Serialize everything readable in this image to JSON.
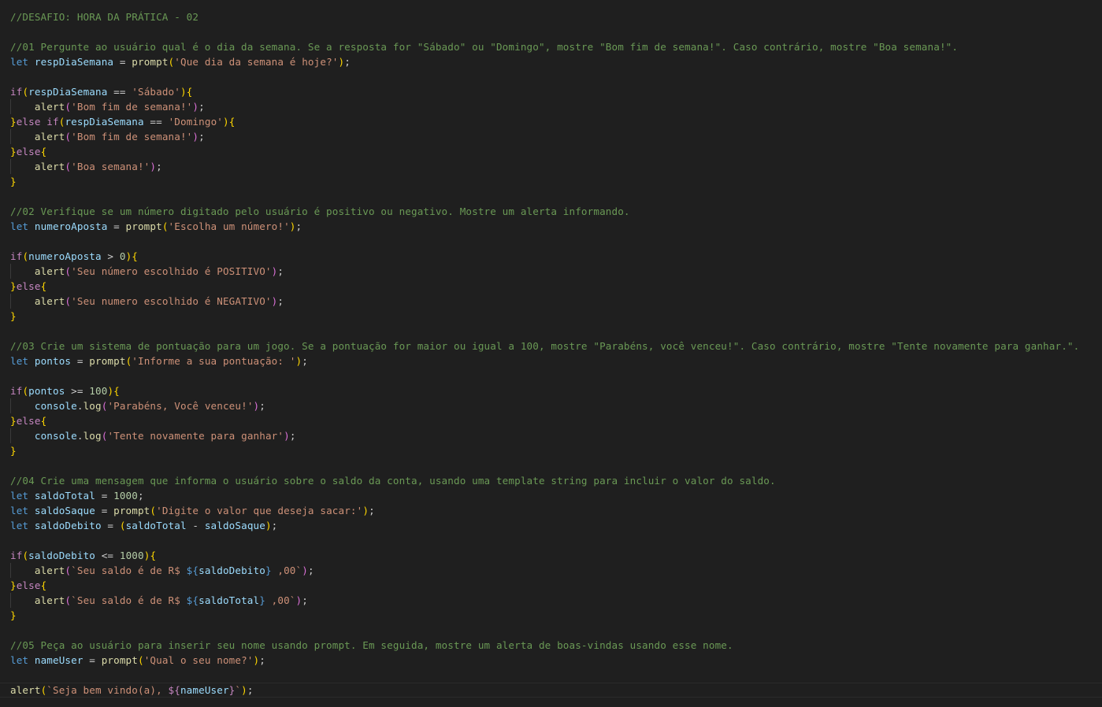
{
  "colors": {
    "background": "#1f1f1f",
    "comment": "#6a9955",
    "keyword": "#569cd6",
    "control": "#c586c0",
    "variable": "#9cdcfe",
    "function": "#dcdcaa",
    "string": "#ce9178",
    "number": "#b5cea8",
    "brace_gold": "#ffd700",
    "brace_purple": "#da70d6",
    "brace_blue": "#179fff",
    "plain": "#cccccc"
  },
  "lines": [
    {
      "tokens": [
        [
          "//DESAFIO: HORA DA PRÁTICA - 02",
          "comment"
        ]
      ]
    },
    {
      "tokens": []
    },
    {
      "tokens": [
        [
          "//01 Pergunte ao usuário qual é o dia da semana. Se a resposta for \"Sábado\" ou \"Domingo\", mostre \"Bom fim de semana!\". Caso contrário, mostre \"Boa semana!\".",
          "comment"
        ]
      ]
    },
    {
      "tokens": [
        [
          "let",
          "keyword"
        ],
        [
          " ",
          "plain"
        ],
        [
          "respDiaSemana",
          "variable"
        ],
        [
          " = ",
          "plain"
        ],
        [
          "prompt",
          "function"
        ],
        [
          "(",
          "brace_gold"
        ],
        [
          "'Que dia da semana é hoje?'",
          "string"
        ],
        [
          ")",
          "brace_gold"
        ],
        [
          ";",
          "plain"
        ]
      ]
    },
    {
      "tokens": []
    },
    {
      "tokens": [
        [
          "if",
          "control"
        ],
        [
          "(",
          "brace_gold"
        ],
        [
          "respDiaSemana",
          "variable"
        ],
        [
          " == ",
          "plain"
        ],
        [
          "'Sábado'",
          "string"
        ],
        [
          ")",
          "brace_gold"
        ],
        [
          "{",
          "brace_gold"
        ]
      ]
    },
    {
      "indent": true,
      "tokens": [
        [
          "    ",
          "plain"
        ],
        [
          "alert",
          "function"
        ],
        [
          "(",
          "brace_purple"
        ],
        [
          "'Bom fim de semana!'",
          "string"
        ],
        [
          ")",
          "brace_purple"
        ],
        [
          ";",
          "plain"
        ]
      ]
    },
    {
      "tokens": [
        [
          "}",
          "brace_gold"
        ],
        [
          "else",
          "control"
        ],
        [
          " ",
          "plain"
        ],
        [
          "if",
          "control"
        ],
        [
          "(",
          "brace_gold"
        ],
        [
          "respDiaSemana",
          "variable"
        ],
        [
          " == ",
          "plain"
        ],
        [
          "'Domingo'",
          "string"
        ],
        [
          ")",
          "brace_gold"
        ],
        [
          "{",
          "brace_gold"
        ]
      ]
    },
    {
      "indent": true,
      "tokens": [
        [
          "    ",
          "plain"
        ],
        [
          "alert",
          "function"
        ],
        [
          "(",
          "brace_purple"
        ],
        [
          "'Bom fim de semana!'",
          "string"
        ],
        [
          ")",
          "brace_purple"
        ],
        [
          ";",
          "plain"
        ]
      ]
    },
    {
      "tokens": [
        [
          "}",
          "brace_gold"
        ],
        [
          "else",
          "control"
        ],
        [
          "{",
          "brace_gold"
        ]
      ]
    },
    {
      "indent": true,
      "tokens": [
        [
          "    ",
          "plain"
        ],
        [
          "alert",
          "function"
        ],
        [
          "(",
          "brace_purple"
        ],
        [
          "'Boa semana!'",
          "string"
        ],
        [
          ")",
          "brace_purple"
        ],
        [
          ";",
          "plain"
        ]
      ]
    },
    {
      "tokens": [
        [
          "}",
          "brace_gold"
        ]
      ]
    },
    {
      "tokens": []
    },
    {
      "tokens": [
        [
          "//02 Verifique se um número digitado pelo usuário é positivo ou negativo. Mostre um alerta informando.",
          "comment"
        ]
      ]
    },
    {
      "tokens": [
        [
          "let",
          "keyword"
        ],
        [
          " ",
          "plain"
        ],
        [
          "numeroAposta",
          "variable"
        ],
        [
          " = ",
          "plain"
        ],
        [
          "prompt",
          "function"
        ],
        [
          "(",
          "brace_gold"
        ],
        [
          "'Escolha um número!'",
          "string"
        ],
        [
          ")",
          "brace_gold"
        ],
        [
          ";",
          "plain"
        ]
      ]
    },
    {
      "tokens": []
    },
    {
      "tokens": [
        [
          "if",
          "control"
        ],
        [
          "(",
          "brace_gold"
        ],
        [
          "numeroAposta",
          "variable"
        ],
        [
          " > ",
          "plain"
        ],
        [
          "0",
          "number"
        ],
        [
          ")",
          "brace_gold"
        ],
        [
          "{",
          "brace_gold"
        ]
      ]
    },
    {
      "indent": true,
      "tokens": [
        [
          "    ",
          "plain"
        ],
        [
          "alert",
          "function"
        ],
        [
          "(",
          "brace_purple"
        ],
        [
          "'Seu número escolhido é POSITIVO'",
          "string"
        ],
        [
          ")",
          "brace_purple"
        ],
        [
          ";",
          "plain"
        ]
      ]
    },
    {
      "tokens": [
        [
          "}",
          "brace_gold"
        ],
        [
          "else",
          "control"
        ],
        [
          "{",
          "brace_gold"
        ]
      ]
    },
    {
      "indent": true,
      "tokens": [
        [
          "    ",
          "plain"
        ],
        [
          "alert",
          "function"
        ],
        [
          "(",
          "brace_purple"
        ],
        [
          "'Seu numero escolhido é NEGATIVO'",
          "string"
        ],
        [
          ")",
          "brace_purple"
        ],
        [
          ";",
          "plain"
        ]
      ]
    },
    {
      "tokens": [
        [
          "}",
          "brace_gold"
        ]
      ]
    },
    {
      "tokens": []
    },
    {
      "tokens": [
        [
          "//03 Crie um sistema de pontuação para um jogo. Se a pontuação for maior ou igual a 100, mostre \"Parabéns, você venceu!\". Caso contrário, mostre \"Tente novamente para ganhar.\".",
          "comment"
        ]
      ]
    },
    {
      "tokens": [
        [
          "let",
          "keyword"
        ],
        [
          " ",
          "plain"
        ],
        [
          "pontos",
          "variable"
        ],
        [
          " = ",
          "plain"
        ],
        [
          "prompt",
          "function"
        ],
        [
          "(",
          "brace_gold"
        ],
        [
          "'Informe a sua pontuação: '",
          "string"
        ],
        [
          ")",
          "brace_gold"
        ],
        [
          ";",
          "plain"
        ]
      ]
    },
    {
      "tokens": []
    },
    {
      "tokens": [
        [
          "if",
          "control"
        ],
        [
          "(",
          "brace_gold"
        ],
        [
          "pontos",
          "variable"
        ],
        [
          " >= ",
          "plain"
        ],
        [
          "100",
          "number"
        ],
        [
          ")",
          "brace_gold"
        ],
        [
          "{",
          "brace_gold"
        ]
      ]
    },
    {
      "indent": true,
      "tokens": [
        [
          "    ",
          "plain"
        ],
        [
          "console",
          "variable"
        ],
        [
          ".",
          "plain"
        ],
        [
          "log",
          "function"
        ],
        [
          "(",
          "brace_purple"
        ],
        [
          "'Parabéns, Você venceu!'",
          "string"
        ],
        [
          ")",
          "brace_purple"
        ],
        [
          ";",
          "plain"
        ]
      ]
    },
    {
      "tokens": [
        [
          "}",
          "brace_gold"
        ],
        [
          "else",
          "control"
        ],
        [
          "{",
          "brace_gold"
        ]
      ]
    },
    {
      "indent": true,
      "tokens": [
        [
          "    ",
          "plain"
        ],
        [
          "console",
          "variable"
        ],
        [
          ".",
          "plain"
        ],
        [
          "log",
          "function"
        ],
        [
          "(",
          "brace_purple"
        ],
        [
          "'Tente novamente para ganhar'",
          "string"
        ],
        [
          ")",
          "brace_purple"
        ],
        [
          ";",
          "plain"
        ]
      ]
    },
    {
      "tokens": [
        [
          "}",
          "brace_gold"
        ]
      ]
    },
    {
      "tokens": []
    },
    {
      "tokens": [
        [
          "//04 Crie uma mensagem que informa o usuário sobre o saldo da conta, usando uma template string para incluir o valor do saldo.",
          "comment"
        ]
      ]
    },
    {
      "tokens": [
        [
          "let",
          "keyword"
        ],
        [
          " ",
          "plain"
        ],
        [
          "saldoTotal",
          "variable"
        ],
        [
          " = ",
          "plain"
        ],
        [
          "1000",
          "number"
        ],
        [
          ";",
          "plain"
        ]
      ]
    },
    {
      "tokens": [
        [
          "let",
          "keyword"
        ],
        [
          " ",
          "plain"
        ],
        [
          "saldoSaque",
          "variable"
        ],
        [
          " = ",
          "plain"
        ],
        [
          "prompt",
          "function"
        ],
        [
          "(",
          "brace_gold"
        ],
        [
          "'Digite o valor que deseja sacar:'",
          "string"
        ],
        [
          ")",
          "brace_gold"
        ],
        [
          ";",
          "plain"
        ]
      ]
    },
    {
      "tokens": [
        [
          "let",
          "keyword"
        ],
        [
          " ",
          "plain"
        ],
        [
          "saldoDebito",
          "variable"
        ],
        [
          " = ",
          "plain"
        ],
        [
          "(",
          "brace_gold"
        ],
        [
          "saldoTotal",
          "variable"
        ],
        [
          " - ",
          "plain"
        ],
        [
          "saldoSaque",
          "variable"
        ],
        [
          ")",
          "brace_gold"
        ],
        [
          ";",
          "plain"
        ]
      ]
    },
    {
      "tokens": []
    },
    {
      "tokens": [
        [
          "if",
          "control"
        ],
        [
          "(",
          "brace_gold"
        ],
        [
          "saldoDebito",
          "variable"
        ],
        [
          " <= ",
          "plain"
        ],
        [
          "1000",
          "number"
        ],
        [
          ")",
          "brace_gold"
        ],
        [
          "{",
          "brace_gold"
        ]
      ]
    },
    {
      "indent": true,
      "tokens": [
        [
          "    ",
          "plain"
        ],
        [
          "alert",
          "function"
        ],
        [
          "(",
          "brace_purple"
        ],
        [
          "`Seu saldo é de R$ ",
          "string"
        ],
        [
          "${",
          "keyword"
        ],
        [
          "saldoDebito",
          "variable"
        ],
        [
          "}",
          "keyword"
        ],
        [
          " ,00`",
          "string"
        ],
        [
          ")",
          "brace_purple"
        ],
        [
          ";",
          "plain"
        ]
      ]
    },
    {
      "tokens": [
        [
          "}",
          "brace_gold"
        ],
        [
          "else",
          "control"
        ],
        [
          "{",
          "brace_gold"
        ]
      ]
    },
    {
      "indent": true,
      "tokens": [
        [
          "    ",
          "plain"
        ],
        [
          "alert",
          "function"
        ],
        [
          "(",
          "brace_purple"
        ],
        [
          "`Seu saldo é de R$ ",
          "string"
        ],
        [
          "${",
          "keyword"
        ],
        [
          "saldoTotal",
          "variable"
        ],
        [
          "}",
          "keyword"
        ],
        [
          " ,00`",
          "string"
        ],
        [
          ")",
          "brace_purple"
        ],
        [
          ";",
          "plain"
        ]
      ]
    },
    {
      "tokens": [
        [
          "}",
          "brace_gold"
        ]
      ]
    },
    {
      "tokens": []
    },
    {
      "tokens": [
        [
          "//05 Peça ao usuário para inserir seu nome usando prompt. Em seguida, mostre um alerta de boas-vindas usando esse nome.",
          "comment"
        ]
      ]
    },
    {
      "tokens": [
        [
          "let",
          "keyword"
        ],
        [
          " ",
          "plain"
        ],
        [
          "nameUser",
          "variable"
        ],
        [
          " = ",
          "plain"
        ],
        [
          "prompt",
          "function"
        ],
        [
          "(",
          "brace_gold"
        ],
        [
          "'Qual o seu nome?'",
          "string"
        ],
        [
          ")",
          "brace_gold"
        ],
        [
          ";",
          "plain"
        ]
      ]
    },
    {
      "tokens": []
    },
    {
      "current": true,
      "tokens": [
        [
          "alert",
          "function"
        ],
        [
          "(",
          "brace_gold"
        ],
        [
          "`Seja bem vindo(a), ",
          "string"
        ],
        [
          "${",
          "control"
        ],
        [
          "nameUser",
          "variable"
        ],
        [
          "}",
          "control"
        ],
        [
          "`",
          "string"
        ],
        [
          ")",
          "brace_gold"
        ],
        [
          ";",
          "plain"
        ]
      ]
    }
  ]
}
